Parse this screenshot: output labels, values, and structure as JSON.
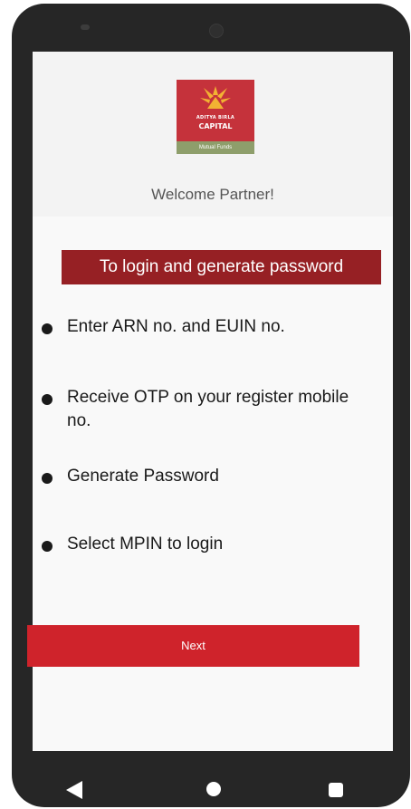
{
  "logo": {
    "brand_line1": "ADITYA BIRLA",
    "brand_line2": "CAPITAL",
    "tagline": "Mutual Funds"
  },
  "welcome_text": "Welcome Partner!",
  "banner_text": "To login and generate password",
  "steps": [
    {
      "text": "Enter ARN no. and EUIN no."
    },
    {
      "text": "Receive OTP on your register mobile no."
    },
    {
      "text": "Generate Password"
    },
    {
      "text": "Select MPIN to login"
    }
  ],
  "next_button_label": "Next",
  "nav_icons": [
    "back-icon",
    "home-icon",
    "recent-apps-icon"
  ],
  "colors": {
    "brand_red": "#c5323b",
    "banner_dark_red": "#962024",
    "button_red": "#cf232b",
    "logo_green": "#8e9e6b"
  }
}
